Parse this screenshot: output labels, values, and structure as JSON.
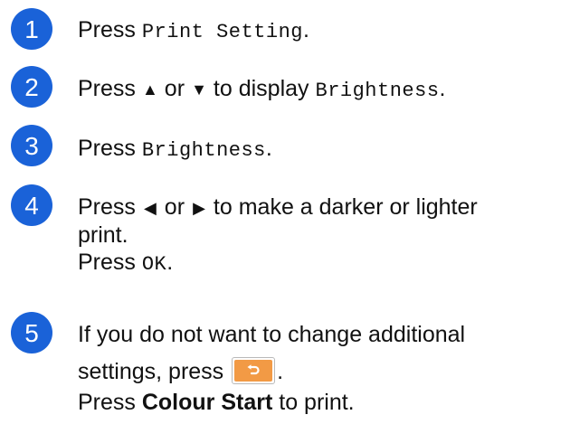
{
  "steps": [
    {
      "number": "1",
      "text_before": "Press ",
      "mono": "Print Setting",
      "text_after": "."
    },
    {
      "number": "2",
      "text_before": "Press ",
      "up_arrow": "▲",
      "text_or": " or ",
      "down_arrow": "▼",
      "text_display": " to display ",
      "mono": "Brightness",
      "text_after": "."
    },
    {
      "number": "3",
      "text_before": "Press ",
      "mono": "Brightness",
      "text_after": "."
    },
    {
      "number": "4",
      "text_before": "Press ",
      "left_arrow": "◀",
      "text_or": " or ",
      "right_arrow": "▶",
      "text_rest": " to make a darker or lighter",
      "line2": "print.",
      "line3_before": "Press ",
      "line3_mono": "OK",
      "line3_after": "."
    },
    {
      "number": "5",
      "line1": "If you do not want to change additional",
      "line2_before": "settings, press ",
      "line2_after": ".",
      "line3_before": "Press ",
      "line3_bold": "Colour Start",
      "line3_after": " to print."
    }
  ],
  "icons": {
    "back_button": "back-arrow-icon"
  },
  "colors": {
    "badge": "#1a62d8",
    "back_button": "#f29a45",
    "text": "#111111"
  }
}
